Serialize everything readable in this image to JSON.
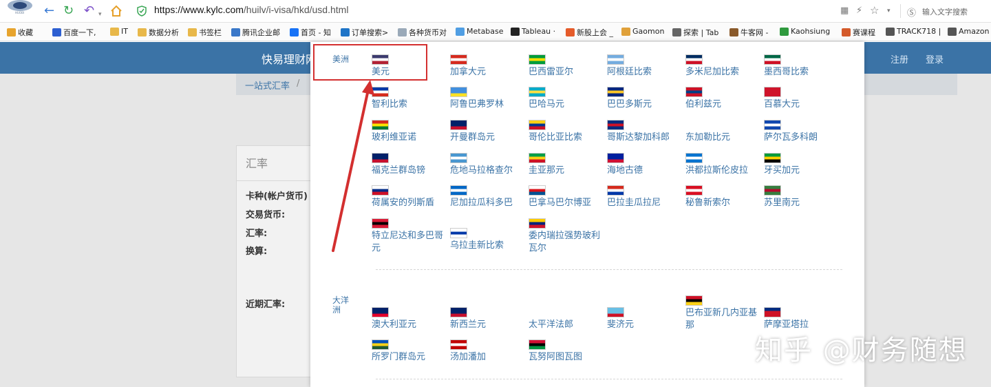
{
  "browser": {
    "url_host": "https://www.kylc.com",
    "url_path": "/huilv/i-visa/hkd/usd.html",
    "search_placeholder": "输入文字搜索"
  },
  "bookmarks": [
    {
      "label": "收藏",
      "icon": "star-icon",
      "color": "#e7a42e"
    },
    {
      "label": "百度一下,",
      "icon": "baidu-paw-icon",
      "color": "#2d5fd1"
    },
    {
      "label": "IT",
      "icon": "folder-icon",
      "color": "#e8b84a"
    },
    {
      "label": "数据分析",
      "icon": "folder-icon",
      "color": "#e8b84a"
    },
    {
      "label": "书签栏",
      "icon": "folder-icon",
      "color": "#e8b84a"
    },
    {
      "label": "腾讯企业邮",
      "icon": "mail-icon",
      "color": "#3a78c9"
    },
    {
      "label": "首页 - 知",
      "icon": "zhihu-icon",
      "color": "#1772f6"
    },
    {
      "label": "订单搜索>",
      "icon": "t-icon",
      "color": "#1e74c7"
    },
    {
      "label": "各种货币对",
      "icon": "globe-icon",
      "color": "#9aa9b8"
    },
    {
      "label": "Metabase",
      "icon": "metabase-icon",
      "color": "#509ee3"
    },
    {
      "label": "Tableau ·",
      "icon": "github-icon",
      "color": "#222222"
    },
    {
      "label": "新股上会 _",
      "icon": "bird-icon",
      "color": "#e55b2a"
    },
    {
      "label": "Gaomon",
      "icon": "gaomon-icon",
      "color": "#e0a13a"
    },
    {
      "label": "探索 | Tab",
      "icon": "dots-icon",
      "color": "#666666"
    },
    {
      "label": "牛客网 -",
      "icon": "nowcoder-icon",
      "color": "#8a5a2b"
    },
    {
      "label": "Kaohsiung",
      "icon": "leaf-icon",
      "color": "#2f9a3e"
    },
    {
      "label": "赛课程",
      "icon": "kakao-icon",
      "color": "#d45a2a"
    },
    {
      "label": "TRACK718 |",
      "icon": "doc-icon",
      "color": "#555555"
    },
    {
      "label": "Amazon",
      "icon": "doc-icon",
      "color": "#555555"
    }
  ],
  "site": {
    "title": "快易理财网",
    "register": "注册",
    "login": "登录",
    "breadcrumb": "一站式汇率",
    "breadcrumb_sep": "/",
    "card_title": "汇率",
    "fields": [
      "卡种(帐户货币)",
      "交易货币:",
      "汇率:",
      "换算:",
      "近期汇率:"
    ]
  },
  "regions": [
    {
      "label": "美洲",
      "currencies": [
        {
          "name": "美元",
          "flag": [
            "#3c3b6e",
            "#ffffff",
            "#b22234"
          ]
        },
        {
          "name": "加拿大元",
          "flag": [
            "#d52b1e",
            "#ffffff",
            "#d52b1e"
          ]
        },
        {
          "name": "巴西雷亚尔",
          "flag": [
            "#009c3b",
            "#ffdf00",
            "#009c3b"
          ]
        },
        {
          "name": "阿根廷比索",
          "flag": [
            "#74acdf",
            "#ffffff",
            "#74acdf"
          ]
        },
        {
          "name": "多米尼加比索",
          "flag": [
            "#002d62",
            "#ffffff",
            "#ce1126"
          ]
        },
        {
          "name": "墨西哥比索",
          "flag": [
            "#006847",
            "#ffffff",
            "#ce1126"
          ]
        },
        {
          "name": "智利比索",
          "flag": [
            "#0039a6",
            "#ffffff",
            "#d52b1e"
          ]
        },
        {
          "name": "阿鲁巴弗罗林",
          "flag": [
            "#418fde",
            "#418fde",
            "#fbe122"
          ]
        },
        {
          "name": "巴哈马元",
          "flag": [
            "#00abc9",
            "#fae042",
            "#00abc9"
          ]
        },
        {
          "name": "巴巴多斯元",
          "flag": [
            "#00267f",
            "#ffc726",
            "#00267f"
          ]
        },
        {
          "name": "伯利兹元",
          "flag": [
            "#ce1126",
            "#003f87",
            "#ce1126"
          ]
        },
        {
          "name": "百慕大元",
          "flag": [
            "#cf142b",
            "#cf142b",
            "#cf142b"
          ]
        },
        {
          "name": "玻利维亚诺",
          "flag": [
            "#d52b1e",
            "#f9e300",
            "#007934"
          ]
        },
        {
          "name": "开曼群岛元",
          "flag": [
            "#012169",
            "#012169",
            "#c8102e"
          ]
        },
        {
          "name": "哥伦比亚比索",
          "flag": [
            "#fcd116",
            "#003893",
            "#ce1126"
          ]
        },
        {
          "name": "哥斯达黎加科郎",
          "flag": [
            "#002b7f",
            "#ce1126",
            "#002b7f"
          ]
        },
        {
          "name": "东加勒比元",
          "flag": []
        },
        {
          "name": "萨尔瓦多科朗",
          "flag": [
            "#0f47af",
            "#ffffff",
            "#0f47af"
          ]
        },
        {
          "name": "福克兰群岛镑",
          "flag": [
            "#012169",
            "#012169",
            "#c8102e"
          ]
        },
        {
          "name": "危地马拉格查尔",
          "flag": [
            "#4997d0",
            "#ffffff",
            "#4997d0"
          ]
        },
        {
          "name": "圭亚那元",
          "flag": [
            "#009e49",
            "#fcd116",
            "#ce1126"
          ]
        },
        {
          "name": "海地古德",
          "flag": [
            "#00209f",
            "#00209f",
            "#d21034"
          ]
        },
        {
          "name": "洪都拉斯伦皮拉",
          "flag": [
            "#0073cf",
            "#ffffff",
            "#0073cf"
          ]
        },
        {
          "name": "牙买加元",
          "flag": [
            "#009b3a",
            "#fed100",
            "#000000"
          ]
        },
        {
          "name": "荷属安的列斯盾",
          "flag": [
            "#ffffff",
            "#012a87",
            "#ce1126"
          ]
        },
        {
          "name": "尼加拉瓜科多巴",
          "flag": [
            "#0067c6",
            "#ffffff",
            "#0067c6"
          ]
        },
        {
          "name": "巴拿马巴尔博亚",
          "flag": [
            "#ffffff",
            "#da121a",
            "#005293"
          ]
        },
        {
          "name": "巴拉圭瓜拉尼",
          "flag": [
            "#d52b1e",
            "#ffffff",
            "#0038a8"
          ]
        },
        {
          "name": "秘鲁新索尔",
          "flag": [
            "#d91023",
            "#ffffff",
            "#d91023"
          ]
        },
        {
          "name": "苏里南元",
          "flag": [
            "#377e3f",
            "#b40a2d",
            "#377e3f"
          ]
        },
        {
          "name": "特立尼达和多巴哥元",
          "flag": [
            "#da1a35",
            "#000000",
            "#da1a35"
          ]
        },
        {
          "name": "乌拉圭新比索",
          "flag": [
            "#ffffff",
            "#0038a8",
            "#ffffff"
          ]
        },
        {
          "name": "委内瑞拉强势玻利瓦尔",
          "flag": [
            "#ffcc00",
            "#00247d",
            "#cf142b"
          ]
        }
      ]
    },
    {
      "label": "大洋洲",
      "currencies": [
        {
          "name": "澳大利亚元",
          "flag": [
            "#012169",
            "#012169",
            "#e4002b"
          ]
        },
        {
          "name": "新西兰元",
          "flag": [
            "#012169",
            "#012169",
            "#c8102e"
          ]
        },
        {
          "name": "太平洋法郎",
          "flag": []
        },
        {
          "name": "斐济元",
          "flag": [
            "#68bfe5",
            "#68bfe5",
            "#ce1126"
          ]
        },
        {
          "name": "巴布亚新几内亚基那",
          "flag": [
            "#ce1126",
            "#000000",
            "#fcd116"
          ]
        },
        {
          "name": "萨摩亚塔拉",
          "flag": [
            "#002b7f",
            "#ce1126",
            "#ce1126"
          ]
        },
        {
          "name": "所罗门群岛元",
          "flag": [
            "#0051ba",
            "#fcd116",
            "#215b33"
          ]
        },
        {
          "name": "汤加潘加",
          "flag": [
            "#c10000",
            "#ffffff",
            "#c10000"
          ]
        },
        {
          "name": "瓦努阿图瓦图",
          "flag": [
            "#d21034",
            "#000000",
            "#009543"
          ]
        }
      ]
    }
  ],
  "watermark": "知乎 @财务随想",
  "colors": {
    "link": "#3b73a6",
    "header": "#3b73a6",
    "highlight": "#d32f2f"
  }
}
